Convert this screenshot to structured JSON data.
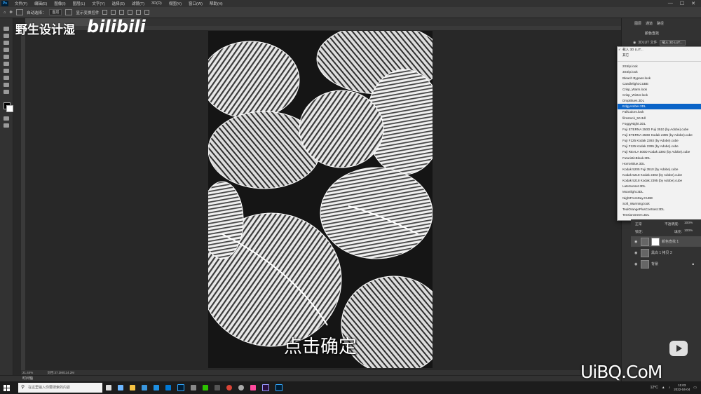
{
  "menubar": {
    "items": [
      "文件(F)",
      "编辑(E)",
      "图像(I)",
      "图层(L)",
      "文字(Y)",
      "选择(S)",
      "滤镜(T)",
      "3D(D)",
      "视图(V)",
      "窗口(W)",
      "帮助(H)"
    ],
    "window_controls": [
      "—",
      "☐",
      "✕"
    ]
  },
  "optionsbar": {
    "auto_select": "自动选择：",
    "layer_mode": "图层",
    "show_transform": "显示变换控件"
  },
  "watermark": {
    "title": "野生设计湿",
    "logo": "bilibili"
  },
  "panel_tabs": [
    "图层",
    "通道",
    "路径"
  ],
  "properties": {
    "header": "颜色查找"
  },
  "lut": {
    "label": "3DLUT 文件",
    "selected": "载入 3D LUT..."
  },
  "dropdown": {
    "top_items": [
      "载入 3D LUT...",
      "其它"
    ],
    "items": [
      "2Strip.look",
      "3Strip.look",
      "Bleach Bypass.look",
      "Candlelight.CUBE",
      "Crisp_Warm.look",
      "Crisp_Winter.look",
      "DropBlues.3DL",
      "EdgyAmber.3DL",
      "FallColors.look",
      "filmstock_50.3dl",
      "FoggyNight.3DL",
      "Fuji ETERNA 250D Fuji 3510 (by Adobe).cube",
      "Fuji ETERNA 250D Kodak 2395 (by Adobe).cube",
      "Fuji F125 Kodak 2393 (by Adobe).cube",
      "Fuji F125 Kodak 2395 (by Adobe).cube",
      "Fuji REALA 500D Kodak 2393 (by Adobe).cube",
      "FuturisticBleak.3DL",
      "HorrorBlue.3DL",
      "Kodak 5205 Fuji 3510 (by Adobe).cube",
      "Kodak 5218 Kodak 2383 (by Adobe).cube",
      "Kodak 5218 Kodak 2395 (by Adobe).cube",
      "LateSunset.3DL",
      "Moonlight.3DL",
      "NightFromDay.CUBE",
      "Soft_Warming.look",
      "TealOrangePlusContrast.3DL",
      "TensionGreen.3DL"
    ],
    "selected": "EdgyAmber.3DL"
  },
  "layers": {
    "blend_mode": "正常",
    "opacity_label": "不透明度:",
    "opacity": "100%",
    "lock_label": "锁定:",
    "fill_label": "填充:",
    "fill": "100%",
    "items": [
      {
        "name": "颜色查找 1",
        "active": true
      },
      {
        "name": "黑白 1 拷贝 2",
        "active": false
      },
      {
        "name": "背景",
        "active": false
      }
    ]
  },
  "document": {
    "tab": "",
    "zoom": "21.44%",
    "doc_info": "文档:37.3M/114.2M"
  },
  "timeline": "时间轴",
  "subtitle": "点击确定",
  "site_watermark": "UiBQ.CoM",
  "taskbar": {
    "search_placeholder": "在这里输入你要搜索的内容",
    "weather": "12°C",
    "time": "11:03",
    "date": "2022-04-04"
  },
  "colors": {
    "accent": "#0a64c8",
    "app_bg": "#282828",
    "panel": "#323232"
  }
}
